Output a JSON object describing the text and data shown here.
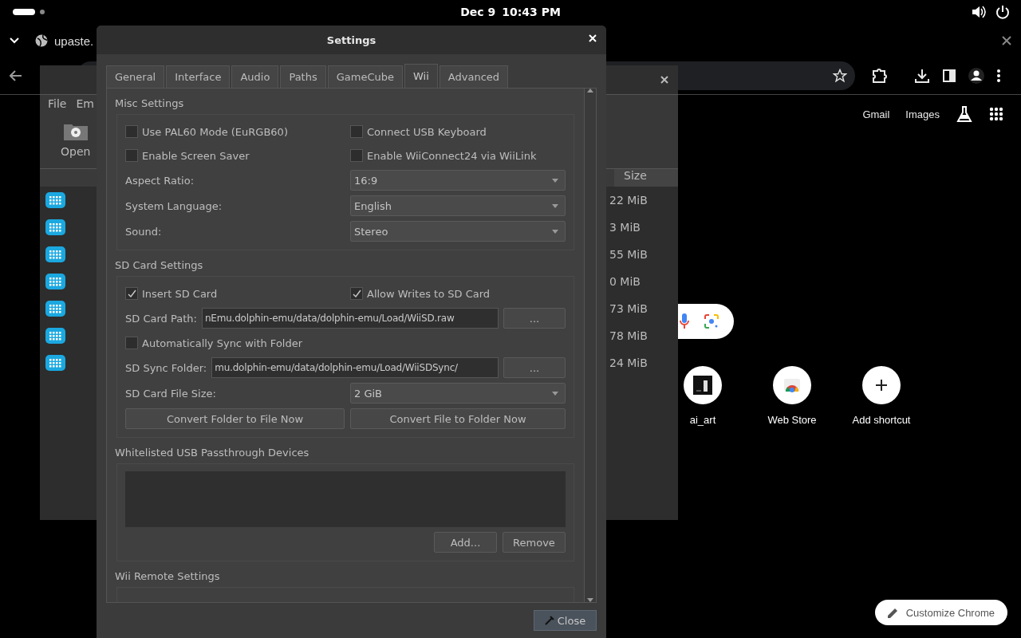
{
  "top_bar": {
    "date": "Dec 9",
    "time": "10:43 PM"
  },
  "browser": {
    "tab_title": "upaste.",
    "header_links": [
      "Gmail",
      "Images"
    ],
    "shortcuts": [
      {
        "label": "ai_art",
        "kind": "picture"
      },
      {
        "label": "Web Store",
        "kind": "store"
      },
      {
        "label": "Add shortcut",
        "kind": "add"
      }
    ],
    "customize_button": "Customize Chrome"
  },
  "game_list_window": {
    "menu": [
      "File",
      "Em"
    ],
    "toolbar": [
      "Open"
    ],
    "size_header": "Size",
    "rows": [
      {
        "size": "22 MiB"
      },
      {
        "size": "3 MiB"
      },
      {
        "size": "55 MiB"
      },
      {
        "size": "0 MiB"
      },
      {
        "size": "73 MiB"
      },
      {
        "size": "78 MiB"
      },
      {
        "size": "24 MiB"
      }
    ]
  },
  "settings": {
    "title": "Settings",
    "tabs": [
      {
        "label": "General",
        "selected": false
      },
      {
        "label": "Interface",
        "selected": false
      },
      {
        "label": "Audio",
        "selected": false
      },
      {
        "label": "Paths",
        "selected": false
      },
      {
        "label": "GameCube",
        "selected": false
      },
      {
        "label": "Wii",
        "selected": true
      },
      {
        "label": "Advanced",
        "selected": false
      }
    ],
    "groups": [
      {
        "title": "Misc Settings",
        "rows": [
          {
            "kind": "checks",
            "items": [
              {
                "label": "Use PAL60 Mode (EuRGB60)",
                "checked": false
              },
              {
                "label": "Connect USB Keyboard",
                "checked": false
              }
            ]
          },
          {
            "kind": "checks",
            "items": [
              {
                "label": "Enable Screen Saver",
                "checked": false
              },
              {
                "label": "Enable WiiConnect24 via WiiLink",
                "checked": false
              }
            ]
          },
          {
            "kind": "combo",
            "label": "Aspect Ratio:",
            "value": "16:9"
          },
          {
            "kind": "combo",
            "label": "System Language:",
            "value": "English"
          },
          {
            "kind": "combo",
            "label": "Sound:",
            "value": "Stereo"
          }
        ]
      },
      {
        "title": "SD Card Settings",
        "rows": [
          {
            "kind": "checks",
            "items": [
              {
                "label": "Insert SD Card",
                "checked": true
              },
              {
                "label": "Allow Writes to SD Card",
                "checked": true
              }
            ]
          },
          {
            "kind": "path",
            "label": "SD Card Path:",
            "value": "nEmu.dolphin-emu/data/dolphin-emu/Load/WiiSD.raw",
            "button": "..."
          },
          {
            "kind": "checks",
            "items": [
              {
                "label": "Automatically Sync with Folder",
                "checked": false
              }
            ]
          },
          {
            "kind": "path",
            "label": "SD Sync Folder:",
            "value": "mu.dolphin-emu/data/dolphin-emu/Load/WiiSDSync/",
            "button": "..."
          },
          {
            "kind": "combo",
            "label": "SD Card File Size:",
            "value": "2 GiB"
          },
          {
            "kind": "button_pair",
            "items": [
              "Convert Folder to File Now",
              "Convert File to Folder Now"
            ]
          }
        ]
      },
      {
        "title": "Whitelisted USB Passthrough Devices",
        "rows": [
          {
            "kind": "list"
          },
          {
            "kind": "actions",
            "items": [
              "Add...",
              "Remove"
            ]
          }
        ]
      },
      {
        "title": "Wii Remote Settings"
      }
    ],
    "close_button": "Close"
  }
}
